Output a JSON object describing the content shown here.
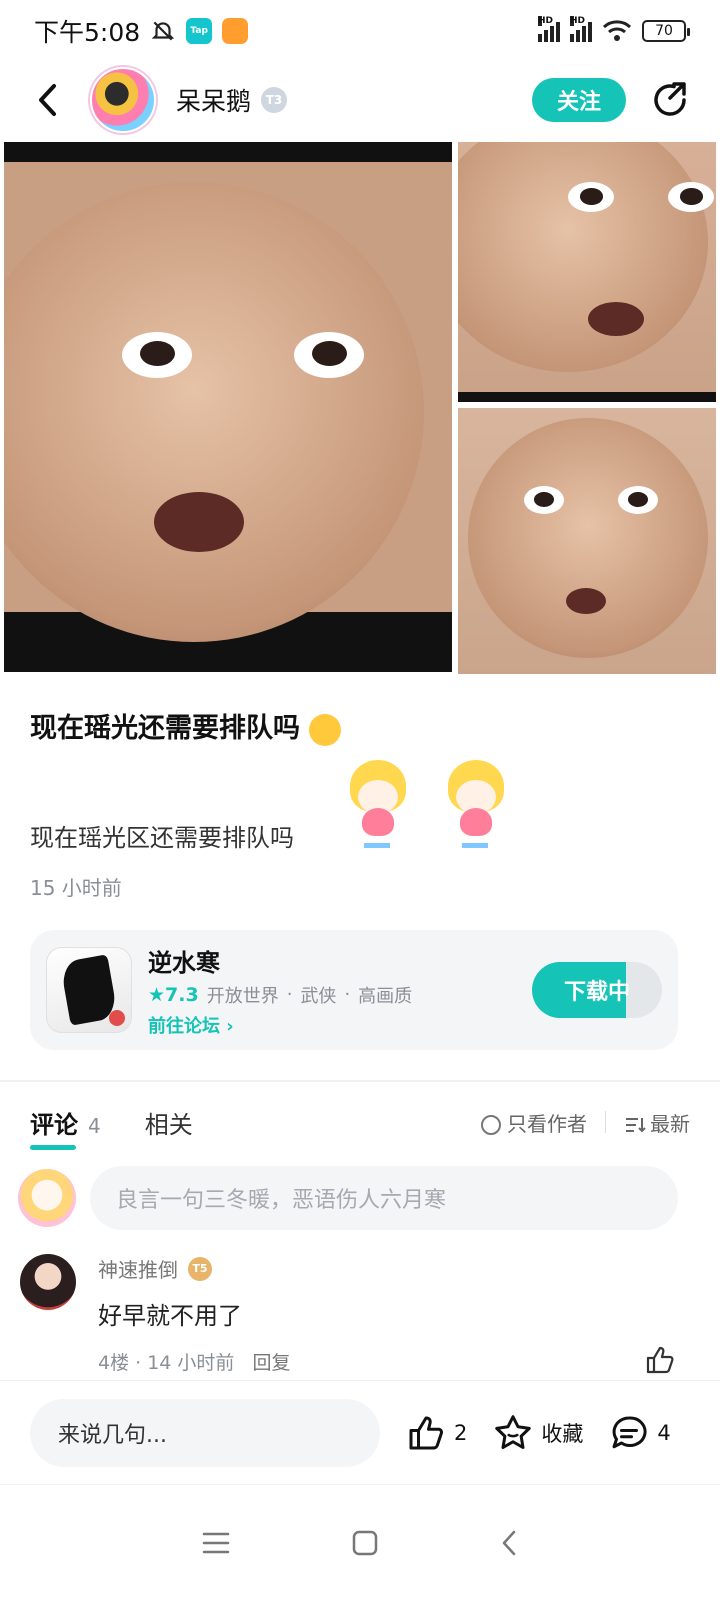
{
  "status": {
    "time": "下午5:08",
    "app_badge": "Tap",
    "signal_label": "HD",
    "battery": "70"
  },
  "header": {
    "user_name": "呆呆鹅",
    "level": "3",
    "follow_label": "关注"
  },
  "post": {
    "title": "现在瑶光还需要排队吗",
    "body": "现在瑶光区还需要排队吗",
    "time": "15 小时前"
  },
  "game": {
    "name": "逆水寒",
    "rating": "★7.3",
    "tags": [
      "开放世界",
      "武侠",
      "高画质"
    ],
    "forum_link": "前往论坛 ›",
    "download_label": "下载中",
    "download_progress": 0.72
  },
  "tabs": {
    "comments_label": "评论",
    "comments_count": "4",
    "related_label": "相关",
    "author_only": "只看作者",
    "sort_label": "最新"
  },
  "comment_input": {
    "placeholder": "良言一句三冬暖，恶语伤人六月寒"
  },
  "comments": [
    {
      "user": "神速推倒",
      "level": "5",
      "text": "好早就不用了",
      "floor": "4楼",
      "time": "14 小时前",
      "reply_label": "回复"
    }
  ],
  "action_bar": {
    "input_placeholder": "来说几句...",
    "like_count": "2",
    "collect_label": "收藏",
    "comment_count": "4"
  },
  "colors": {
    "accent": "#16c4b7"
  }
}
